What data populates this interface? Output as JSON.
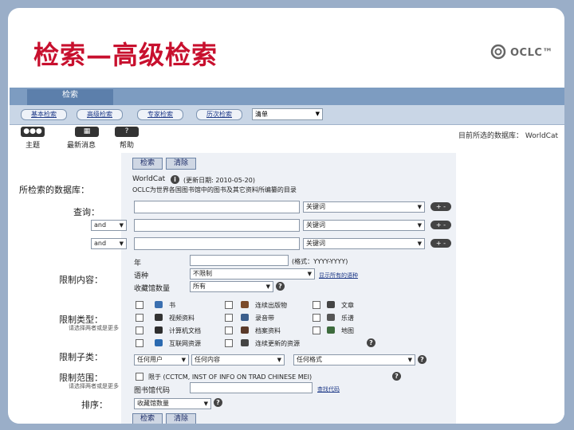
{
  "slide": {
    "title": "检索—高级检索",
    "logo_text": "OCLC™"
  },
  "tabs": {
    "main": "检索"
  },
  "nav": {
    "basic": "基本检索",
    "advanced": "高级检索",
    "expert": "专家检索",
    "history": "历次检索",
    "select": "清单"
  },
  "icons": {
    "topic": {
      "label": "主题",
      "glyph": "●●●"
    },
    "news": {
      "label": "最新消息",
      "glyph": "▦"
    },
    "help": {
      "label": "帮助",
      "glyph": "?"
    }
  },
  "current_db": "目前所选的数据库：  WorldCat",
  "buttons": {
    "search": "检索",
    "clear": "清除"
  },
  "db": {
    "label": "所检索的数据库：",
    "name": "WorldCat",
    "updated": "(更新日期: 2010-05-20)",
    "desc": "OCLC为世界各国图书馆中的图书及其它资料所编纂的目录"
  },
  "query": {
    "label": "查询：",
    "rows": [
      {
        "op": "",
        "field": "关键词"
      },
      {
        "op": "and",
        "field": "关键词"
      },
      {
        "op": "and",
        "field": "关键词"
      }
    ],
    "plus": "+ -"
  },
  "limit_content": {
    "label": "限制内容：",
    "year_label": "年",
    "year_hint": "(格式：YYYY-YYYY)",
    "lang_label": "语种",
    "lang_value": "不限制",
    "lang_link": "显示所有的语种",
    "holdings_label": "收藏馆数量",
    "holdings_value": "所有"
  },
  "limit_type": {
    "label": "限制类型：",
    "sub": "请选择两者或是更多",
    "items": [
      {
        "text": "书",
        "color": "#3a6fb0"
      },
      {
        "text": "连续出版物",
        "color": "#7a4a2a"
      },
      {
        "text": "文章",
        "color": "#444444"
      },
      {
        "text": "视频资料",
        "color": "#333333"
      },
      {
        "text": "录音带",
        "color": "#3b5e8c"
      },
      {
        "text": "乐谱",
        "color": "#555555"
      },
      {
        "text": "计算机文档",
        "color": "#2e2e2e"
      },
      {
        "text": "档案资料",
        "color": "#5a3a2a"
      },
      {
        "text": "地图",
        "color": "#3d6b3d"
      },
      {
        "text": "互联网资源",
        "color": "#2b6ab0"
      },
      {
        "text": "连续更新的资源",
        "color": "#444444"
      }
    ]
  },
  "limit_sub": {
    "label": "限制子类：",
    "values": [
      "任何用户",
      "任何内容",
      "任何格式"
    ]
  },
  "limit_scope": {
    "label": "限制范围：",
    "sub": "请选择两者或是更多",
    "check_text": "限于 (CCTCM, INST OF INFO ON TRAD CHINESE MEI)",
    "libcode_label": "图书馆代码",
    "libcode_link": "查找代码"
  },
  "sort": {
    "label": "排序：",
    "value": "收藏馆数量"
  }
}
